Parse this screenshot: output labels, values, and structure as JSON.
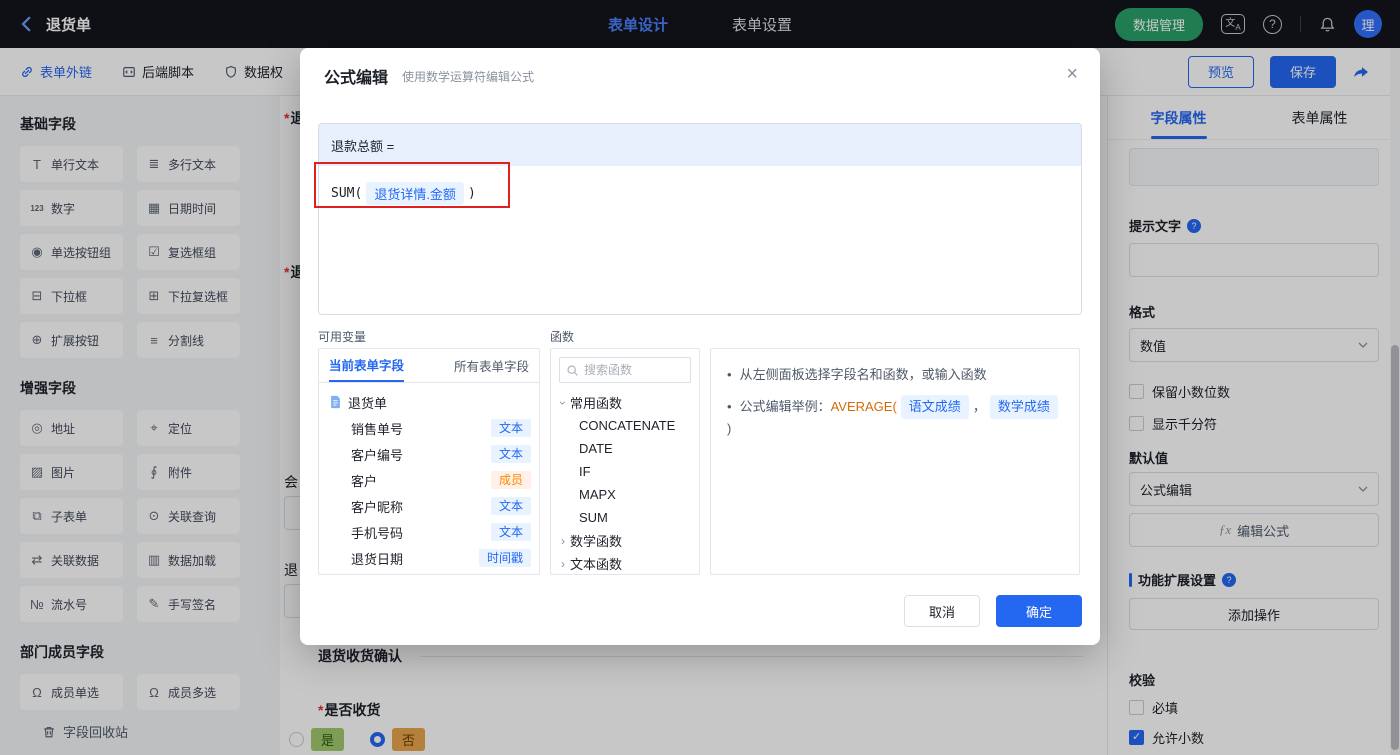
{
  "colors": {
    "primary": "#2468f2",
    "green_button": "#2aa06a",
    "annotation_red": "#e01f1f"
  },
  "header": {
    "title": "退货单",
    "tab_design": "表单设计",
    "tab_settings": "表单设置",
    "data_manage": "数据管理",
    "avatar_text": "理"
  },
  "toolbar": {
    "link_label": "表单外链",
    "script_label": "后端脚本",
    "perm_label": "数据权",
    "preview": "预览",
    "save": "保存"
  },
  "palette": {
    "section1_title": "基础字段",
    "section2_title": "增强字段",
    "section3_title": "部门成员字段",
    "recycle": "字段回收站",
    "s1": [
      {
        "icon": "T",
        "label": "单行文本"
      },
      {
        "icon": "≣",
        "label": "多行文本"
      },
      {
        "icon": "123",
        "label": "数字"
      },
      {
        "icon": "▦",
        "label": "日期时间"
      },
      {
        "icon": "◉",
        "label": "单选按钮组"
      },
      {
        "icon": "☑",
        "label": "复选框组"
      },
      {
        "icon": "⊟",
        "label": "下拉框"
      },
      {
        "icon": "⊞",
        "label": "下拉复选框"
      },
      {
        "icon": "⊕",
        "label": "扩展按钮"
      },
      {
        "icon": "≡",
        "label": "分割线"
      }
    ],
    "s2": [
      {
        "icon": "◎",
        "label": "地址"
      },
      {
        "icon": "⌖",
        "label": "定位"
      },
      {
        "icon": "▨",
        "label": "图片"
      },
      {
        "icon": "∮",
        "label": "附件"
      },
      {
        "icon": "⧉",
        "label": "子表单"
      },
      {
        "icon": "⊙",
        "label": "关联查询"
      },
      {
        "icon": "⇄",
        "label": "关联数据"
      },
      {
        "icon": "▥",
        "label": "数据加载"
      },
      {
        "icon": "№",
        "label": "流水号"
      },
      {
        "icon": "✎",
        "label": "手写签名"
      }
    ],
    "s3": [
      {
        "icon": "Ω",
        "label": "成员单选"
      },
      {
        "icon": "Ω",
        "label": "成员多选"
      }
    ]
  },
  "canvas": {
    "required_mark": "*",
    "clip1": "退",
    "clip2": "退",
    "clip3": "会",
    "clip4": "退",
    "section_divider": "退货收货确认",
    "question": "是否收货",
    "opt_yes": "是",
    "opt_no": "否"
  },
  "props": {
    "tab_field": "字段属性",
    "tab_form": "表单属性",
    "hint_label": "提示文字",
    "help_q": "?",
    "format_label": "格式",
    "format_value": "数值",
    "chk_decimal": "保留小数位数",
    "chk_thousand": "显示千分符",
    "default_label": "默认值",
    "default_value": "公式编辑",
    "fx": "ƒx",
    "edit_formula_btn": "编辑公式",
    "ext_label": "功能扩展设置",
    "add_action_btn": "添加操作",
    "validate_label": "校验",
    "chk_required": "必填",
    "chk_allow_decimal": "允许小数"
  },
  "modal": {
    "title": "公式编辑",
    "subtitle": "使用数学运算符编辑公式",
    "close": "×",
    "formula_target": "退款总额 =",
    "formula_fn": "SUM(",
    "formula_field": "退货详情.金额",
    "formula_close": ")",
    "vars_label": "可用变量",
    "vars_tab_current": "当前表单字段",
    "vars_tab_all": "所有表单字段",
    "tree_root": "退货单",
    "tree": [
      {
        "name": "销售单号",
        "tag": "文本"
      },
      {
        "name": "客户编号",
        "tag": "文本"
      },
      {
        "name": "客户",
        "tag": "成员"
      },
      {
        "name": "客户昵称",
        "tag": "文本"
      },
      {
        "name": "手机号码",
        "tag": "文本"
      },
      {
        "name": "退货日期",
        "tag": "时间戳"
      }
    ],
    "fn_label": "函数",
    "fn_search_placeholder": "搜索函数",
    "fn_group_common": "常用函数",
    "fns": [
      "CONCATENATE",
      "DATE",
      "IF",
      "MAPX",
      "SUM"
    ],
    "fn_group_math": "数学函数",
    "fn_group_text": "文本函数",
    "chev_open": "›",
    "chev_closed": "›",
    "bullet": "•",
    "tip1": "从左侧面板选择字段名和函数，或输入函数",
    "tip2_prefix": "公式编辑举例：",
    "tip2_fn": "AVERAGE(",
    "tip2_field1": "语文成绩",
    "tip2_comma": "，",
    "tip2_field2": "数学成绩",
    "tip2_close": ")",
    "cancel": "取消",
    "confirm": "确定"
  }
}
